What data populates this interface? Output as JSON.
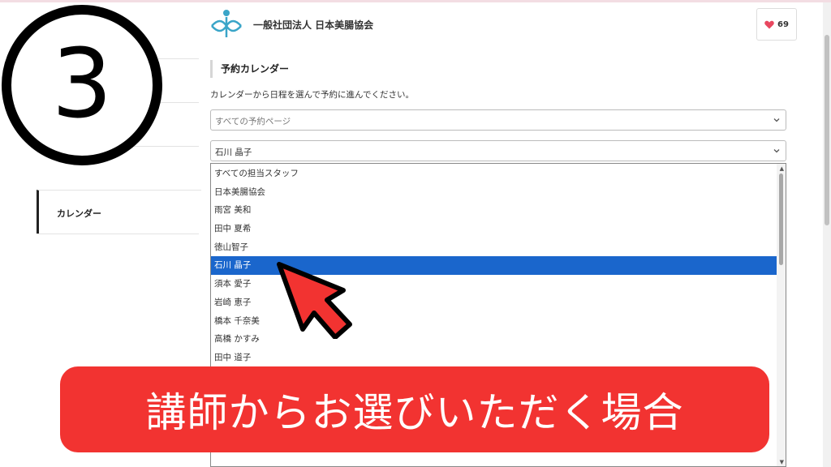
{
  "header": {
    "org_name": "一般社団法人 日本美腸協会",
    "like_count": "69",
    "colors": {
      "accent": "#1a66cc",
      "like_heart": "#e8475f",
      "logo": "#3aa5c8"
    }
  },
  "step_badge": {
    "number": "3"
  },
  "sidebar": {
    "items": [
      {
        "label": ""
      },
      {
        "label": ""
      },
      {
        "label": ""
      },
      {
        "label": "カレンダー",
        "active": true
      }
    ]
  },
  "calendar": {
    "title": "予約カレンダー",
    "instruction": "カレンダーから日程を選んで予約に進んでください。",
    "page_select": {
      "value": "すべての予約ページ"
    },
    "staff_select": {
      "value": "石川 晶子"
    }
  },
  "dropdown": {
    "options": [
      {
        "label": "すべての担当スタッフ",
        "selected": false
      },
      {
        "label": "日本美腸協会",
        "selected": false
      },
      {
        "label": "雨宮 美和",
        "selected": false
      },
      {
        "label": "田中 夏希",
        "selected": false
      },
      {
        "label": "徳山智子",
        "selected": false
      },
      {
        "label": "石川 晶子",
        "selected": true
      },
      {
        "label": "須本 愛子",
        "selected": false
      },
      {
        "label": "岩崎 恵子",
        "selected": false
      },
      {
        "label": "橋本 千奈美",
        "selected": false
      },
      {
        "label": "高橋 かすみ",
        "selected": false
      },
      {
        "label": "田中 道子",
        "selected": false
      },
      {
        "label": "",
        "selected": false
      },
      {
        "label": "",
        "selected": false
      },
      {
        "label": "",
        "selected": false
      },
      {
        "label": "",
        "selected": false
      },
      {
        "label": "",
        "selected": false
      }
    ]
  },
  "banner": {
    "text": "講師からお選びいただく場合",
    "color": "#f23331"
  }
}
